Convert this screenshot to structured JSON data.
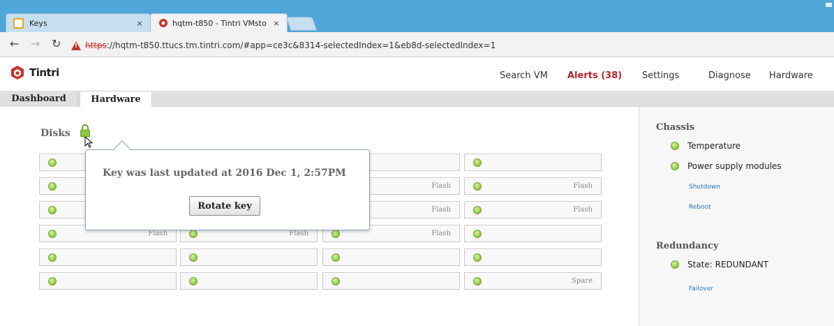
{
  "browser": {
    "tabs": [
      {
        "title": "Keys",
        "close": "×"
      },
      {
        "title": "hqtm-t850 - Tintri VMsto",
        "close": "×"
      }
    ],
    "url_scheme": "https",
    "url_rest": "://hqtm-t850.ttucs.tm.tintri.com/#app=ce3c&8314-selectedIndex=1&eb8d-selectedIndex=1"
  },
  "app": {
    "logo_text": "Tintri",
    "nav": {
      "search_vm": "Search VM",
      "alerts": "Alerts (38)",
      "settings": "Settings",
      "diagnose": "Diagnose",
      "hardware": "Hardware"
    },
    "tabs": {
      "dashboard": "Dashboard",
      "hardware": "Hardware"
    }
  },
  "disks": {
    "title": "Disks",
    "rows": [
      [
        "",
        "",
        "",
        ""
      ],
      [
        "",
        "",
        "Flash",
        "Flash"
      ],
      [
        "",
        "",
        "Flash",
        "Flash"
      ],
      [
        "Flash",
        "Flash",
        "Flash",
        ""
      ],
      [
        "",
        "",
        "",
        ""
      ],
      [
        "",
        "",
        "",
        "Spare"
      ]
    ]
  },
  "popover": {
    "text": "Key was last updated at 2016 Dec 1, 2:57PM",
    "button": "Rotate key"
  },
  "sidebar": {
    "chassis": {
      "title": "Chassis",
      "items": [
        "Temperature",
        "Power supply modules"
      ],
      "links": [
        "Shutdown",
        "Reboot"
      ]
    },
    "redundancy": {
      "title": "Redundancy",
      "items": [
        "State: REDUNDANT"
      ],
      "links": [
        "Failover"
      ]
    }
  },
  "colors": {
    "status_ok": "#8cc63f",
    "alert": "#b3232a",
    "link": "#2672c0",
    "chrome": "#4fa6d8"
  }
}
